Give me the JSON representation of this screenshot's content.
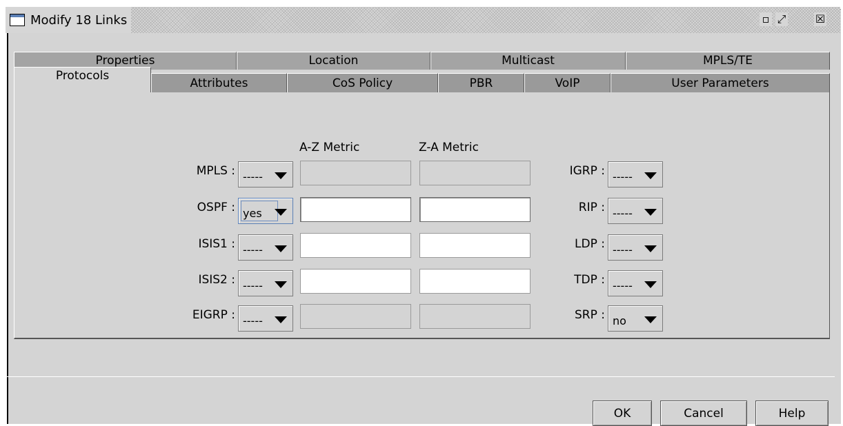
{
  "window": {
    "title": "Modify 18 Links",
    "controls": {
      "restore": "▫",
      "maximize": "⤢",
      "close": "☒"
    }
  },
  "tabs": {
    "back_row": [
      "Properties",
      "Location",
      "Multicast",
      "MPLS/TE"
    ],
    "front_row": [
      "Protocols",
      "Attributes",
      "CoS Policy",
      "PBR",
      "VoIP",
      "User Parameters"
    ],
    "active": "Protocols"
  },
  "columns": {
    "az": "A-Z Metric",
    "za": "Z-A Metric"
  },
  "left_protocols": [
    {
      "label": "MPLS :",
      "value": "-----",
      "az": "",
      "za": "",
      "enabled": false
    },
    {
      "label": "OSPF :",
      "value": "yes",
      "az": "",
      "za": "",
      "enabled": true
    },
    {
      "label": "ISIS1 :",
      "value": "-----",
      "az": "",
      "za": "",
      "enabled": true
    },
    {
      "label": "ISIS2 :",
      "value": "-----",
      "az": "",
      "za": "",
      "enabled": true
    },
    {
      "label": "EIGRP :",
      "value": "-----",
      "az": "",
      "za": "",
      "enabled": false
    }
  ],
  "right_protocols": [
    {
      "label": "IGRP :",
      "value": "-----"
    },
    {
      "label": "RIP :",
      "value": "-----"
    },
    {
      "label": "LDP :",
      "value": "-----"
    },
    {
      "label": "TDP :",
      "value": "-----"
    },
    {
      "label": "SRP :",
      "value": "no"
    }
  ],
  "buttons": {
    "ok": "OK",
    "cancel": "Cancel",
    "help": "Help"
  }
}
